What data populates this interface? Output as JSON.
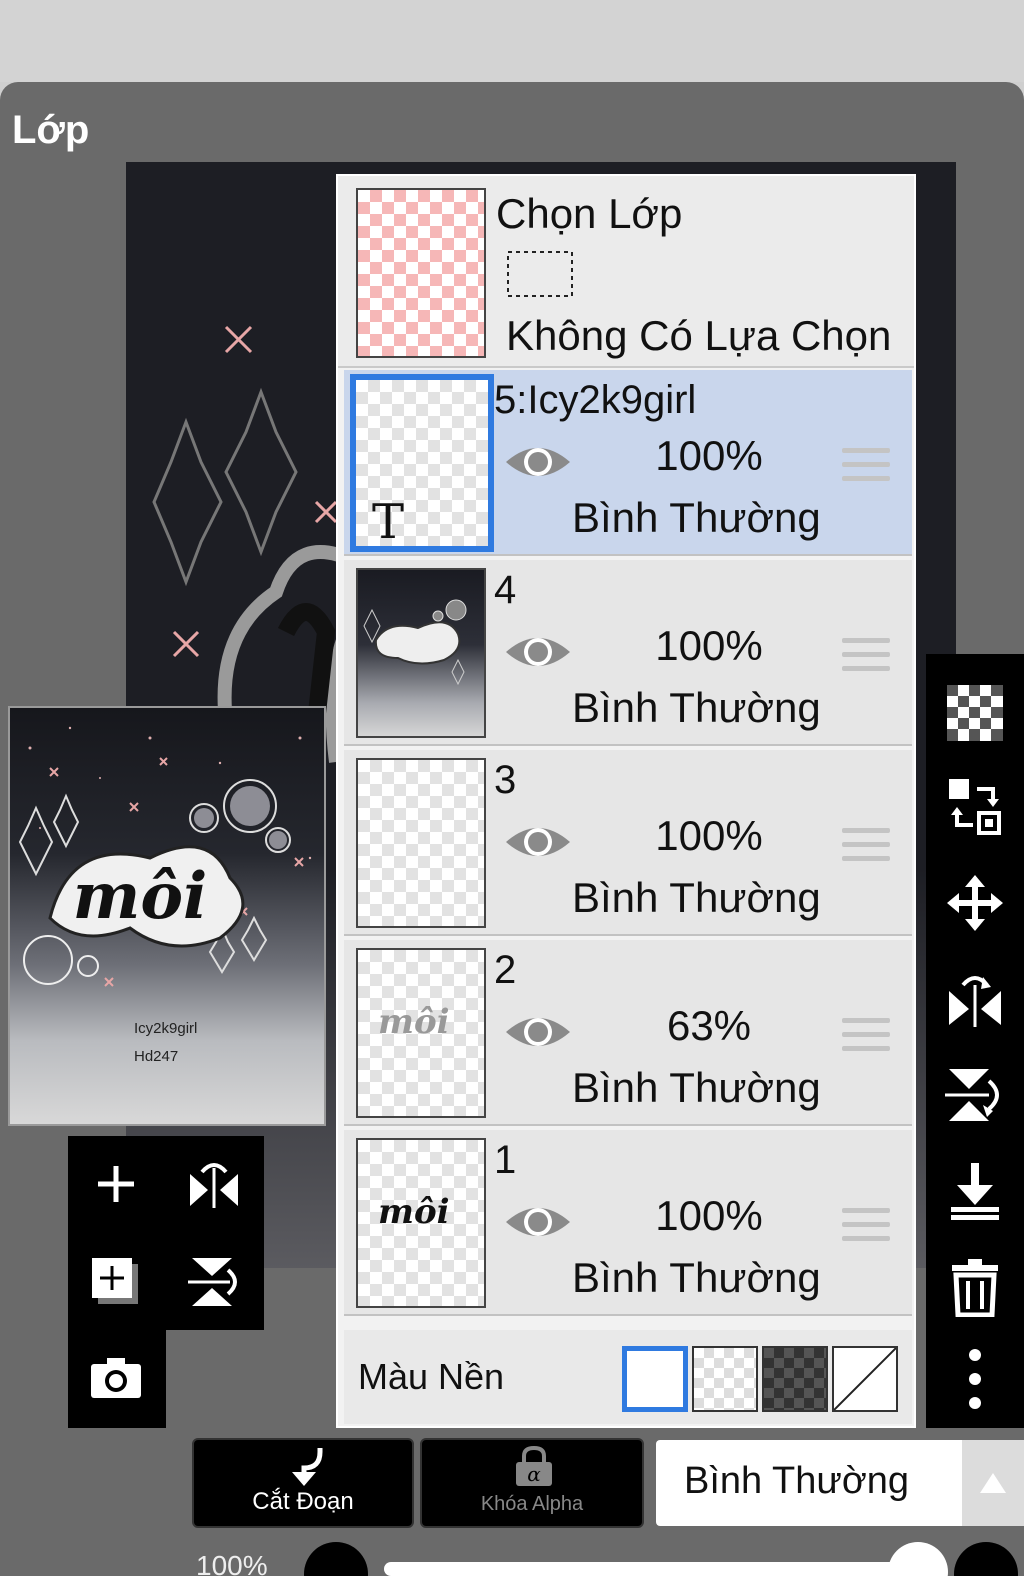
{
  "panel": {
    "title": "Lớp"
  },
  "selection": {
    "title": "Chọn Lớp",
    "status": "Không Có Lựa Chọn"
  },
  "layers": [
    {
      "name": "5:Icy2k9girl",
      "opacity": "100%",
      "blend": "Bình Thường",
      "active": true
    },
    {
      "name": "4",
      "opacity": "100%",
      "blend": "Bình Thường",
      "active": false
    },
    {
      "name": "3",
      "opacity": "100%",
      "blend": "Bình Thường",
      "active": false
    },
    {
      "name": "2",
      "opacity": "63%",
      "blend": "Bình Thường",
      "active": false
    },
    {
      "name": "1",
      "opacity": "100%",
      "blend": "Bình Thường",
      "active": false
    }
  ],
  "thumbs": {
    "layer5_glyph": "T",
    "layer2_text": "môi",
    "layer1_text": "môi"
  },
  "preview": {
    "caption_1": "Icy2k9girl",
    "caption_2": "Hd247",
    "art_text": "môi"
  },
  "background": {
    "label": "Màu Nền"
  },
  "bottom": {
    "clip_label": "Cắt Đoạn",
    "alpha_label": "Khóa Alpha",
    "blend_value": "Bình Thường",
    "zoom": "100%"
  },
  "colors": {
    "accent": "#2f7ae0",
    "active_row": "#c9d6ec",
    "panel_bg": "#6a6a6a"
  },
  "icons": {
    "left_tools": [
      "add-layer-icon",
      "flip-horizontal-icon",
      "add-copy-layer-icon",
      "flip-vertical-icon",
      "camera-icon"
    ],
    "right_tools": [
      "transparency-icon",
      "swap-icon",
      "move-icon",
      "flip-horizontal-icon",
      "flip-vertical-icon",
      "merge-down-icon",
      "trash-icon",
      "more-icon"
    ]
  }
}
